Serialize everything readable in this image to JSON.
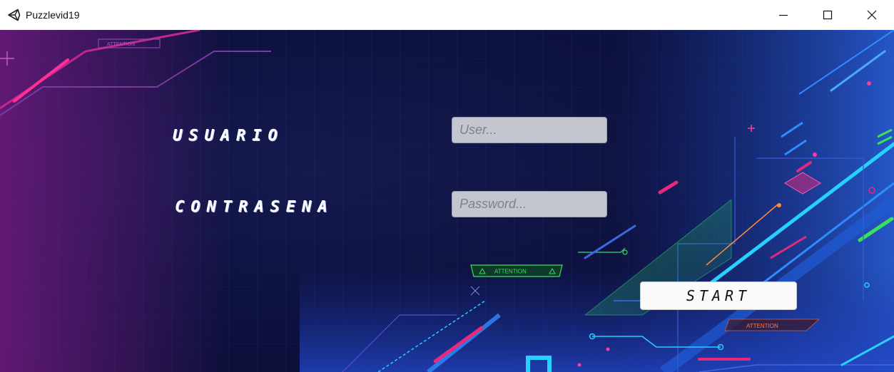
{
  "window": {
    "title": "Puzzlevid19"
  },
  "form": {
    "user_label": "Usuario",
    "user_placeholder": "User...",
    "user_value": "",
    "password_label": "Contrasena",
    "password_placeholder": "Password...",
    "password_value": "",
    "start_label": "Start"
  },
  "decor": {
    "attention_top": "ATTENTION",
    "attention_mid": "ATTENTION",
    "attention_right": "ATTENTION"
  },
  "icons": {
    "app": "unity-logo-icon",
    "minimize": "minimize-icon",
    "maximize": "maximize-icon",
    "close": "close-icon"
  },
  "colors": {
    "background": "#0e1240",
    "neon_pink": "#e8287a",
    "neon_blue": "#2f8cff",
    "neon_cyan": "#26d0ff",
    "neon_green": "#39e05a",
    "input_bg": "#c4c6cf",
    "button_bg": "#fafafa"
  }
}
